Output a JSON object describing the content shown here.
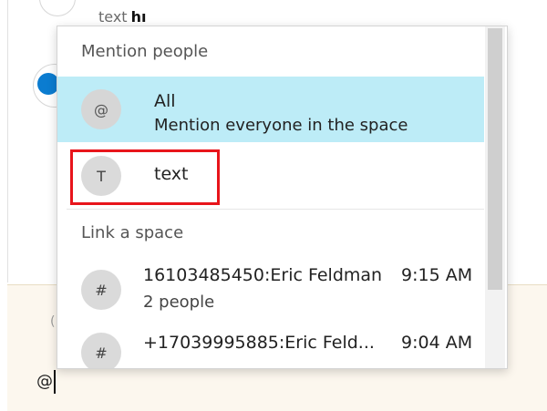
{
  "chat": {
    "top_message_sender": "text",
    "top_message_text": "hı"
  },
  "compose": {
    "value": "@",
    "placeholder_fragment": "("
  },
  "popup": {
    "mention_header": "Mention people",
    "mention_items": [
      {
        "avatar": "@",
        "name": "All",
        "description": "Mention everyone in the space"
      },
      {
        "avatar": "T",
        "name": "text"
      }
    ],
    "link_header": "Link a space",
    "spaces": [
      {
        "avatar": "#",
        "name": "16103485450:Eric Feldman",
        "time": "9:15 AM",
        "people": "2 people"
      },
      {
        "avatar": "#",
        "name": "+17039995885:Eric Feld...",
        "time": "9:04 AM"
      }
    ]
  },
  "colors": {
    "highlight": "#bdecf7",
    "annotation_box": "#e8151b",
    "compose_bg": "#fcf7ee"
  }
}
